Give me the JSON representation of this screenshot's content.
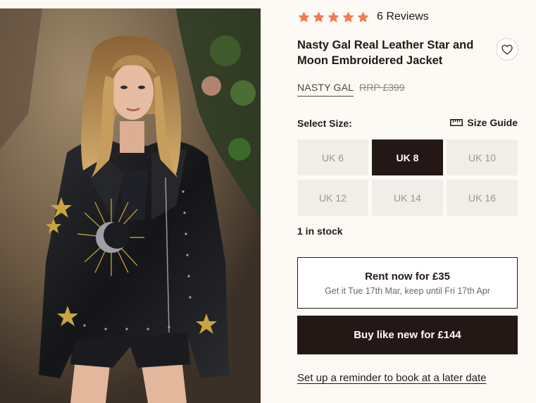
{
  "product": {
    "rating_count": 5,
    "reviews_label": "6 Reviews",
    "title": "Nasty Gal Real Leather Star and Moon Embroidered Jacket",
    "brand": "NASTY GAL",
    "rrp": "RRP £399",
    "image_icon": "model-wearing-leather-jacket"
  },
  "size": {
    "label": "Select Size:",
    "guide_label": "Size Guide",
    "options": [
      "UK 6",
      "UK 8",
      "UK 10",
      "UK 12",
      "UK 14",
      "UK 16"
    ],
    "selected": "UK 8"
  },
  "stock": "1 in stock",
  "rent": {
    "main": "Rent now for £35",
    "sub": "Get it Tue 17th Mar, keep until Fri 17th Apr"
  },
  "buy_label": "Buy like new for £144",
  "reminder_label": "Set up a reminder to book at a later date",
  "colors": {
    "star": "#f07c55",
    "dark": "#231815",
    "background": "#fdfaf5",
    "size_tile": "#f1ede8"
  }
}
